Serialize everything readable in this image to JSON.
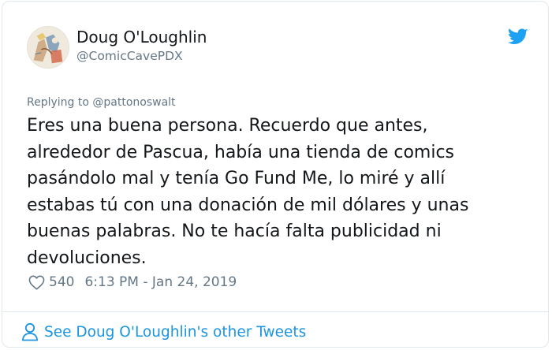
{
  "tweet": {
    "display_name": "Doug O'Loughlin",
    "handle": "@ComicCavePDX",
    "reply_prefix": "Replying to",
    "reply_to": "@pattonoswalt",
    "text_lines": [
      "Eres una buena persona. Recuerdo que antes,",
      "alrededor de Pascua, había una tienda de comics",
      "pasándolo mal y tenía Go Fund Me, lo miré y allí",
      "estabas tú con una donación de mil dólares y unas",
      "buenas palabras. No te hacía falta publicidad ni",
      "devoluciones."
    ],
    "likes": "540",
    "timestamp": "6:13 PM - Jan 24, 2019",
    "footer_link": "See Doug O'Loughlin's other Tweets"
  },
  "icons": {
    "brand": "twitter-bird-icon",
    "like": "heart-icon",
    "profile": "person-icon"
  },
  "colors": {
    "twitter_blue": "#1da1f2",
    "link_blue": "#1b95e0",
    "secondary_text": "#657786",
    "primary_text": "#14171a",
    "border": "#e1e8ed"
  }
}
